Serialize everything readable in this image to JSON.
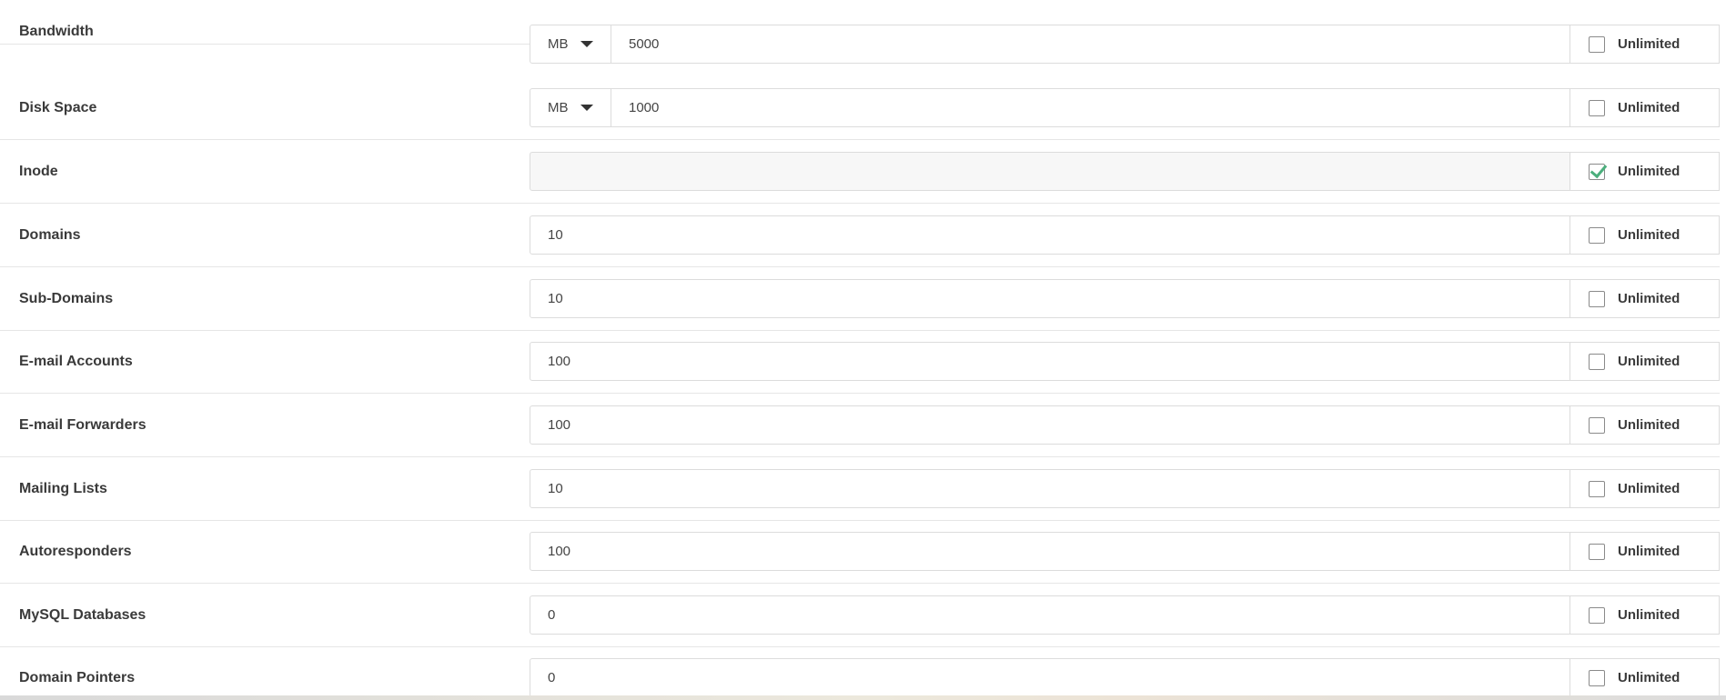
{
  "unlimited_label": "Unlimited",
  "rows": [
    {
      "label": "Bandwidth",
      "unit": "MB",
      "value": "5000",
      "unlimited": false
    },
    {
      "label": "Disk Space",
      "unit": "MB",
      "value": "1000",
      "unlimited": false
    },
    {
      "label": "Inode",
      "value": "",
      "unlimited": true
    },
    {
      "label": "Domains",
      "value": "10",
      "unlimited": false
    },
    {
      "label": "Sub-Domains",
      "value": "10",
      "unlimited": false
    },
    {
      "label": "E-mail Accounts",
      "value": "100",
      "unlimited": false
    },
    {
      "label": "E-mail Forwarders",
      "value": "100",
      "unlimited": false
    },
    {
      "label": "Mailing Lists",
      "value": "10",
      "unlimited": false
    },
    {
      "label": "Autoresponders",
      "value": "100",
      "unlimited": false
    },
    {
      "label": "MySQL Databases",
      "value": "0",
      "unlimited": false
    },
    {
      "label": "Domain Pointers",
      "value": "0",
      "unlimited": false
    }
  ],
  "colors": {
    "check": "#4caf7d",
    "border": "#dcdcdc",
    "disabled_bg": "#f7f7f7"
  },
  "icons": {
    "unit_dropdown": "caret-down-icon",
    "checked": "checkmark-icon"
  }
}
